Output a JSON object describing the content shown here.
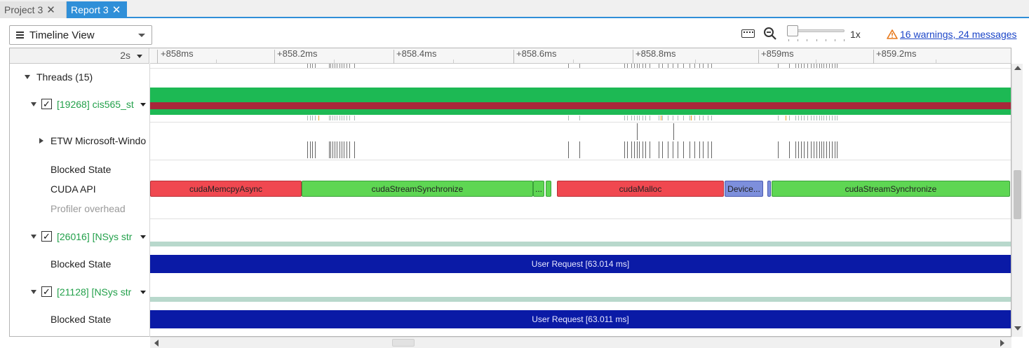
{
  "tabs": [
    {
      "label": "Project 3",
      "active": false
    },
    {
      "label": "Report 3",
      "active": true
    }
  ],
  "toolbar": {
    "view_label": "Timeline View",
    "zoom_level": "1x",
    "warnings_link": "16 warnings, 24 messages",
    "warning_color": "#e8791a"
  },
  "ruler": {
    "scale": "2s",
    "ticks": [
      "+858ms",
      "+858.2ms",
      "+858.4ms",
      "+858.6ms",
      "+858.8ms",
      "+859ms",
      "+859.2ms"
    ]
  },
  "tree": {
    "threads_group": "Threads (15)",
    "thread1": {
      "name": "[19268] cis565_st",
      "checked": true
    },
    "etw": "ETW Microsoft-Windo",
    "blocked_state_1": "Blocked State",
    "cuda_api": "CUDA API",
    "profiler_overhead": "Profiler overhead",
    "thread2": {
      "name": "[26016] [NSys str",
      "checked": true
    },
    "blocked_state_2": "Blocked State",
    "thread3": {
      "name": "[21128] [NSys str",
      "checked": true
    },
    "blocked_state_3": "Blocked State"
  },
  "cuda_calls": [
    {
      "label": "cudaMemcpyAsync",
      "kind": "red"
    },
    {
      "label": "cudaStreamSynchronize",
      "kind": "green"
    },
    {
      "label": "...",
      "kind": "green"
    },
    {
      "label": "",
      "kind": "green"
    },
    {
      "label": "cudaMalloc",
      "kind": "red"
    },
    {
      "label": "Device...",
      "kind": "blue"
    },
    {
      "label": "",
      "kind": "blue"
    },
    {
      "label": "cudaStreamSynchronize",
      "kind": "green"
    }
  ],
  "user_requests": {
    "thread2": "User Request [63.014 ms]",
    "thread3": "User Request [63.011 ms]"
  },
  "colors": {
    "thread_green": "#22a04a",
    "cpu_green": "#1db954",
    "cpu_red": "#a8283a",
    "user_request_blue": "#0a1aa6",
    "tab_active": "#2f8fd8"
  }
}
